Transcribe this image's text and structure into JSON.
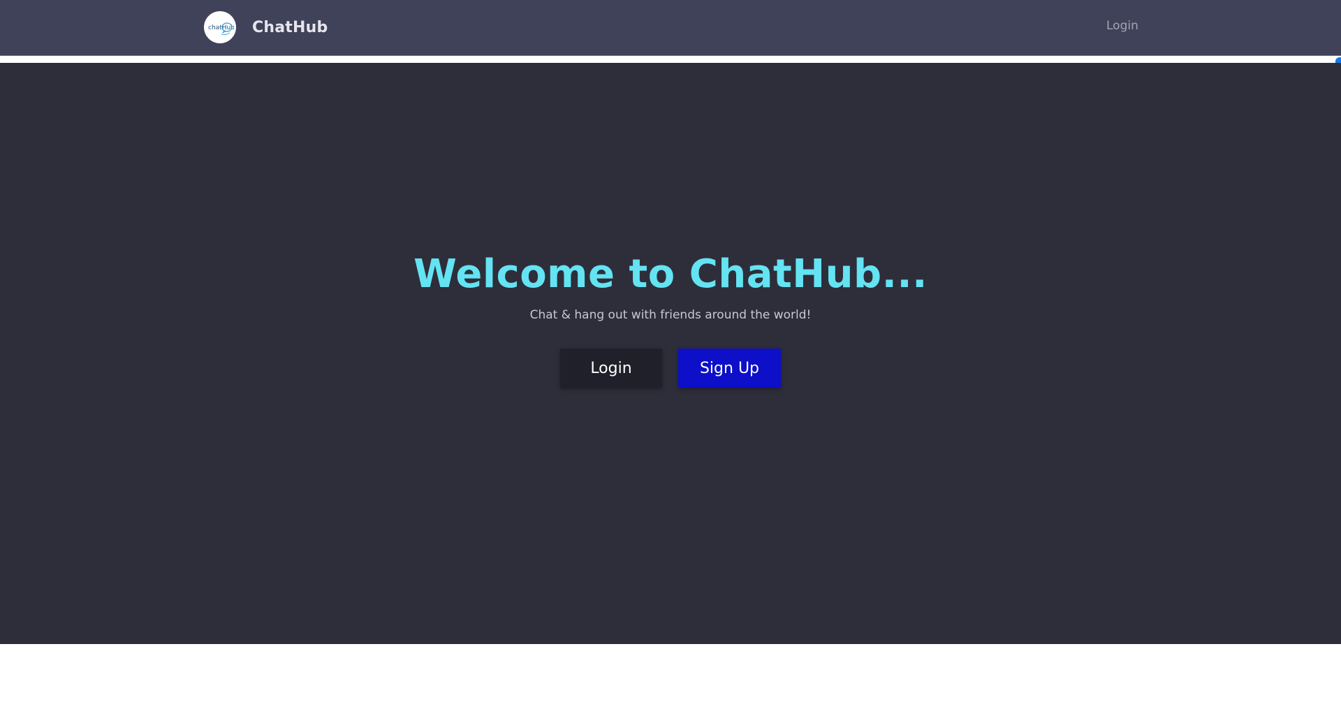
{
  "navbar": {
    "brand_name": "ChatHub",
    "logo_text": "chatHub",
    "login_label": "Login",
    "background": "#40425a"
  },
  "hero": {
    "title": "Welcome to ChatHub...",
    "subtitle": "Chat & hang out with friends around the world!",
    "login_button": "Login",
    "signup_button": "Sign Up",
    "title_color": "#64e3f2",
    "background": "#2e2e3a",
    "signup_color": "#0d0fc9",
    "login_color": "#20202a"
  }
}
